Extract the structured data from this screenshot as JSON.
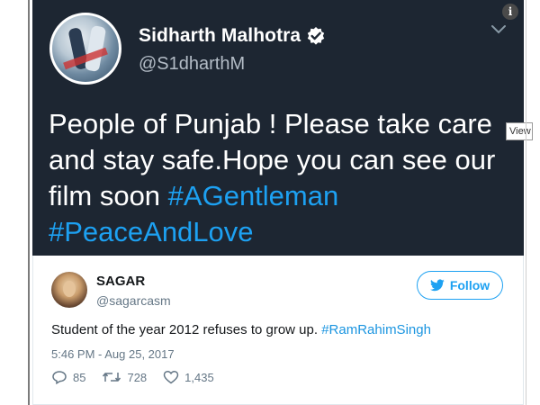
{
  "header_tweet": {
    "name": "Sidharth Malhotra",
    "handle": "@S1dharthM",
    "text_plain": "People of Punjab ! Please take care and stay safe.Hope you can see our film soon ",
    "hashtag1": "#AGentleman",
    "hashtag2": "#PeaceAndLove",
    "background_color": "#1d2632",
    "hashtag_color": "#1da1f2"
  },
  "tooltip": {
    "text": "View"
  },
  "embedded_tweet": {
    "name": "SAGAR",
    "handle": "@sagarcasm",
    "follow_label": "Follow",
    "text_plain": "Student of the year 2012 refuses to grow up. ",
    "hashtag": "#RamRahimSingh",
    "timestamp": "5:46 PM - Aug 25, 2017",
    "replies": "85",
    "retweets": "728",
    "likes": "1,435",
    "accent_color": "#1da1f2"
  },
  "icons": [
    "verified-badge-icon",
    "chevron-down-icon",
    "info-icon",
    "twitter-bird-icon",
    "reply-icon",
    "retweet-icon",
    "like-heart-icon"
  ]
}
